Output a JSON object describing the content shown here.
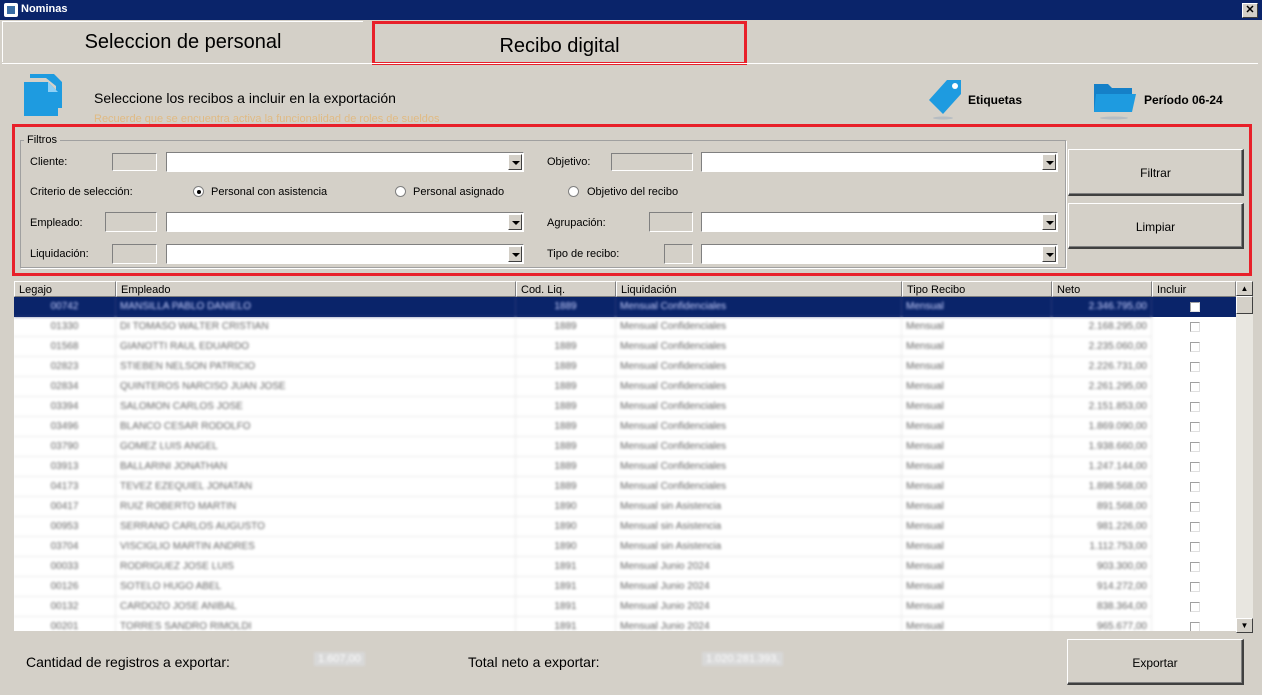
{
  "window": {
    "title": "Nominas",
    "close_glyph": "✕"
  },
  "tabs": [
    {
      "label": "Seleccion de personal"
    },
    {
      "label": "Recibo digital"
    }
  ],
  "header": {
    "instruction": "Seleccione los recibos a incluir en la exportación",
    "notice": "Recuerde que se encuentra activa la funcionalidad de roles de sueldos",
    "etiquetas_label": "Etiquetas",
    "periodo_label": "Período 06-24"
  },
  "filters": {
    "legend": "Filtros",
    "cliente_label": "Cliente:",
    "objetivo_label": "Objetivo:",
    "criterio_label": "Criterio de selección:",
    "radio_options": [
      "Personal con asistencia",
      "Personal asignado",
      "Objetivo del recibo"
    ],
    "radio_selected": 0,
    "empleado_label": "Empleado:",
    "agrupacion_label": "Agrupación:",
    "liquidacion_label": "Liquidación:",
    "tipo_recibo_label": "Tipo de recibo:",
    "filtrar_label": "Filtrar",
    "limpiar_label": "Limpiar"
  },
  "table": {
    "headers": [
      "Legajo",
      "Empleado",
      "Cod. Liq.",
      "Liquidación",
      "Tipo Recibo",
      "Neto",
      "Incluir"
    ],
    "rows": [
      [
        "00742",
        "MANSILLA PABLO DANIELO",
        "1889",
        "Mensual Confidenciales",
        "Mensual",
        "2.346.795,00"
      ],
      [
        "01330",
        "DI TOMASO WALTER CRISTIAN",
        "1889",
        "Mensual Confidenciales",
        "Mensual",
        "2.168.295,00"
      ],
      [
        "01568",
        "GIANOTTI RAUL EDUARDO",
        "1889",
        "Mensual Confidenciales",
        "Mensual",
        "2.235.060,00"
      ],
      [
        "02823",
        "STIEBEN NELSON PATRICIO",
        "1889",
        "Mensual Confidenciales",
        "Mensual",
        "2.226.731,00"
      ],
      [
        "02834",
        "QUINTEROS NARCISO JUAN JOSE",
        "1889",
        "Mensual Confidenciales",
        "Mensual",
        "2.261.295,00"
      ],
      [
        "03394",
        "SALOMON CARLOS JOSE",
        "1889",
        "Mensual Confidenciales",
        "Mensual",
        "2.151.853,00"
      ],
      [
        "03496",
        "BLANCO CESAR RODOLFO",
        "1889",
        "Mensual Confidenciales",
        "Mensual",
        "1.869.090,00"
      ],
      [
        "03790",
        "GOMEZ LUIS ANGEL",
        "1889",
        "Mensual Confidenciales",
        "Mensual",
        "1.938.660,00"
      ],
      [
        "03913",
        "BALLARINI JONATHAN",
        "1889",
        "Mensual Confidenciales",
        "Mensual",
        "1.247.144,00"
      ],
      [
        "04173",
        "TEVEZ EZEQUIEL JONATAN",
        "1889",
        "Mensual Confidenciales",
        "Mensual",
        "1.898.568,00"
      ],
      [
        "00417",
        "RUIZ ROBERTO MARTIN",
        "1890",
        "Mensual sin Asistencia",
        "Mensual",
        "891.568,00"
      ],
      [
        "00953",
        "SERRANO CARLOS AUGUSTO",
        "1890",
        "Mensual sin Asistencia",
        "Mensual",
        "981.226,00"
      ],
      [
        "03704",
        "VISCIGLIO MARTIN ANDRES",
        "1890",
        "Mensual sin Asistencia",
        "Mensual",
        "1.112.753,00"
      ],
      [
        "00033",
        "RODRIGUEZ JOSE LUIS",
        "1891",
        "Mensual Junio 2024",
        "Mensual",
        "903.300,00"
      ],
      [
        "00126",
        "SOTELO HUGO ABEL",
        "1891",
        "Mensual Junio 2024",
        "Mensual",
        "914.272,00"
      ],
      [
        "00132",
        "CARDOZO JOSE ANIBAL",
        "1891",
        "Mensual Junio 2024",
        "Mensual",
        "838.364,00"
      ],
      [
        "00201",
        "TORRES SANDRO RIMOLDI",
        "1891",
        "Mensual Junio 2024",
        "Mensual",
        "965.677,00"
      ]
    ]
  },
  "footer": {
    "cantidad_label": "Cantidad de registros a exportar:",
    "cantidad_value": "1.607,00",
    "total_label": "Total neto a exportar:",
    "total_value": "1.020.281.393,",
    "exportar_label": "Exportar"
  },
  "colors": {
    "highlight_red": "#e8202a",
    "titlebar": "#0a246a",
    "selection": "#0a246a",
    "face": "#d4d0c8",
    "accent_blue": "#1e9be0"
  },
  "icons": [
    "document-icon",
    "tag-icon",
    "folder-icon",
    "close-icon",
    "chevron-down-icon",
    "arrow-up-icon",
    "arrow-down-icon"
  ]
}
